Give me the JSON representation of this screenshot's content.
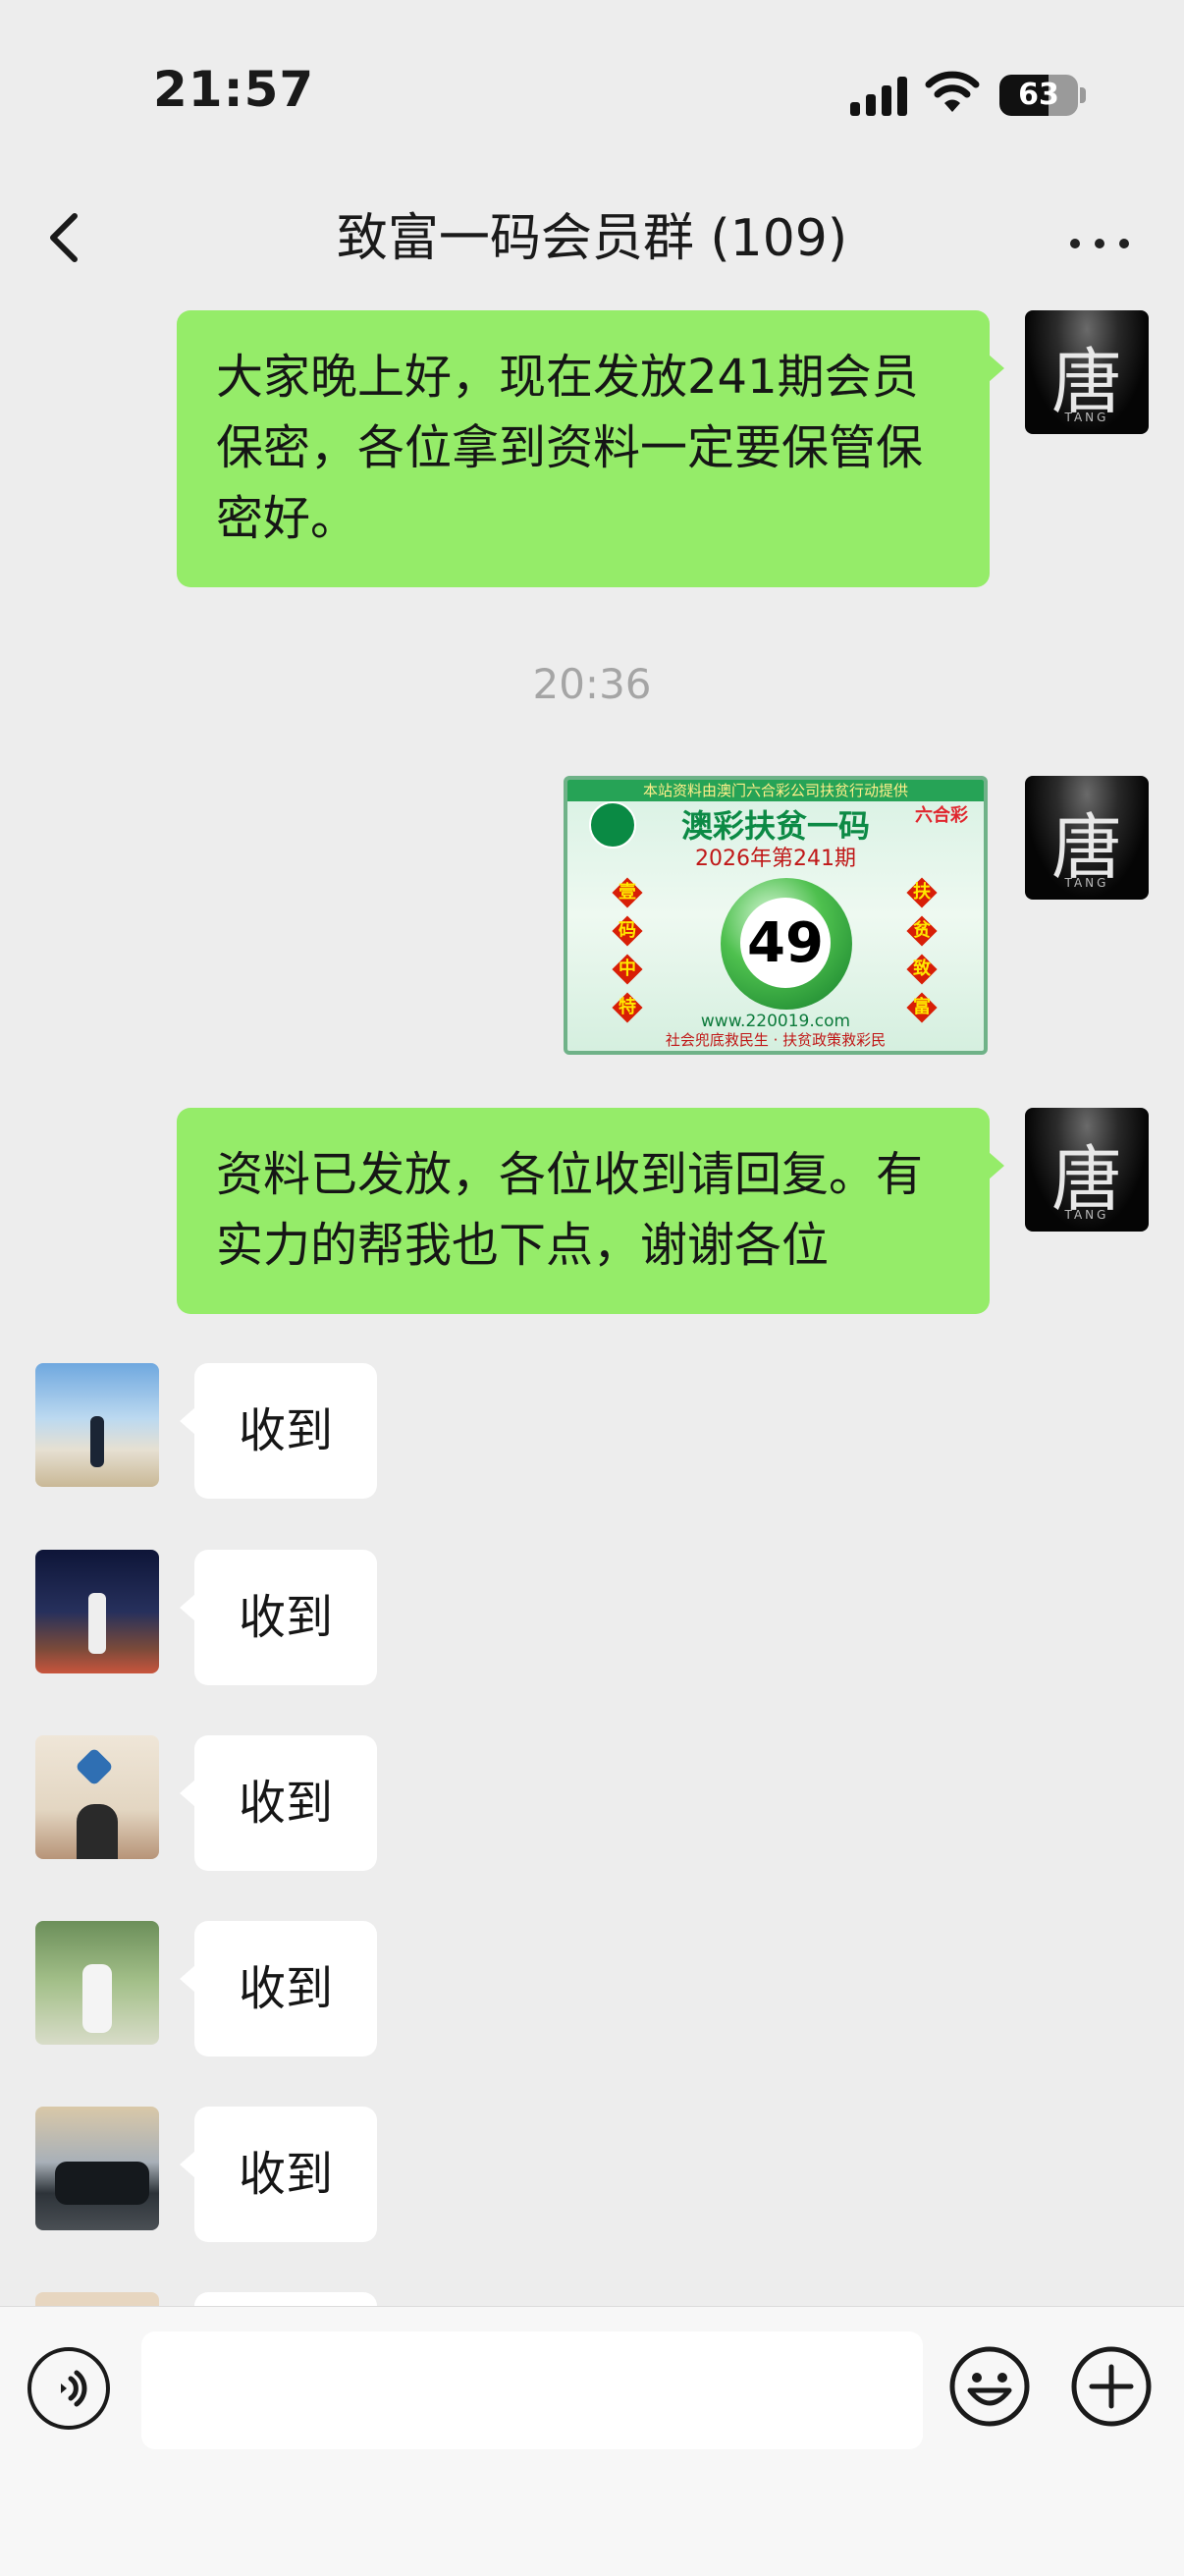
{
  "status_bar": {
    "time": "21:57",
    "battery": "63"
  },
  "header": {
    "title": "致富一码会员群 (109)"
  },
  "messages_out": [
    {
      "text": "大家晚上好，现在发放241期会员保密，各位拿到资料一定要保管保密好。"
    },
    {
      "text": "资料已发放，各位收到请回复。有实力的帮我也下点，谢谢各位"
    }
  ],
  "avatar_me": {
    "glyph": "唐",
    "sub": "TANG"
  },
  "timestamp": "20:36",
  "image_message": {
    "banner": "本站资料由澳门六合彩公司扶贫行动提供",
    "heading": "澳彩扶贫一码",
    "issue": "2026年第241期",
    "left_chars": [
      "壹",
      "码",
      "中",
      "特"
    ],
    "right_chars": [
      "扶",
      "贫",
      "致",
      "富"
    ],
    "number": "49",
    "url": "www.220019.com",
    "slogan": "社会兜底救民生 · 扶贫政策救彩民",
    "logo": "六合彩"
  },
  "replies": [
    {
      "text": "收到",
      "avatar": "beach"
    },
    {
      "text": "收到",
      "avatar": "night"
    },
    {
      "text": "收到",
      "avatar": "office"
    },
    {
      "text": "收到",
      "avatar": "garden"
    },
    {
      "text": "收到",
      "avatar": "car"
    }
  ],
  "input": {
    "placeholder": ""
  },
  "colors": {
    "bubble_out": "#95ec69",
    "bubble_in": "#ffffff",
    "background": "#ededed"
  }
}
